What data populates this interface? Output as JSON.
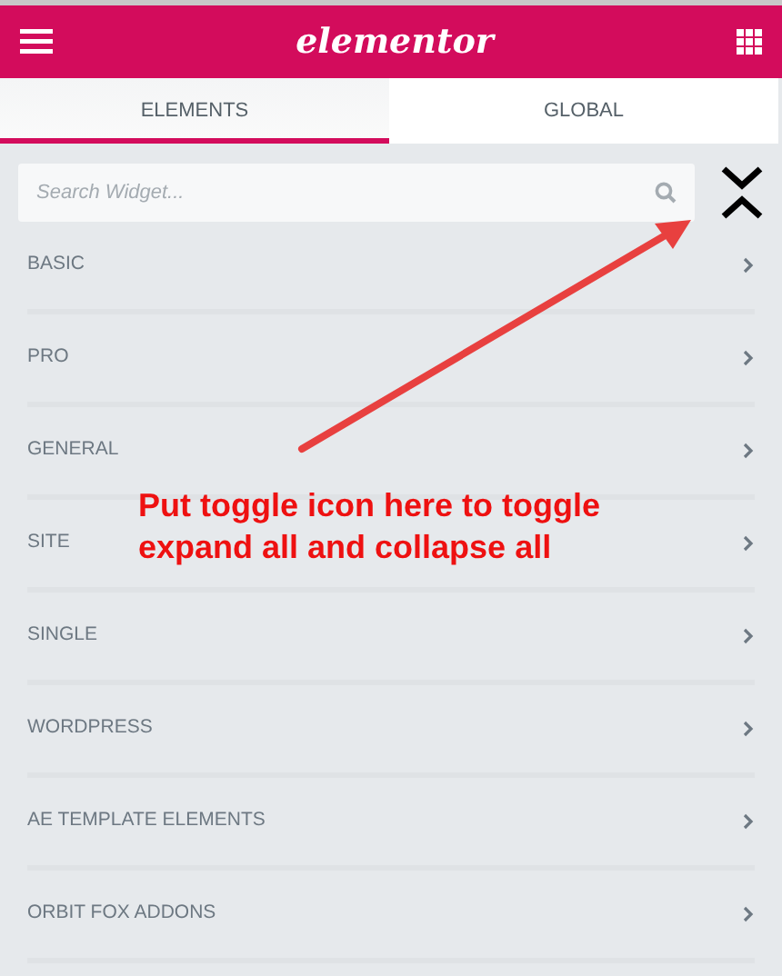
{
  "header": {
    "logo": "elementor"
  },
  "tabs": [
    {
      "label": "ELEMENTS",
      "selected": true
    },
    {
      "label": "GLOBAL",
      "selected": false
    }
  ],
  "search": {
    "placeholder": "Search Widget..."
  },
  "categories": [
    {
      "label": "BASIC"
    },
    {
      "label": "PRO"
    },
    {
      "label": "GENERAL"
    },
    {
      "label": "SITE"
    },
    {
      "label": "SINGLE"
    },
    {
      "label": "WORDPRESS"
    },
    {
      "label": "AE TEMPLATE ELEMENTS"
    },
    {
      "label": "ORBIT FOX ADDONS"
    }
  ],
  "annotation": {
    "text": "Put toggle icon here to toggle expand all and collapse all"
  }
}
